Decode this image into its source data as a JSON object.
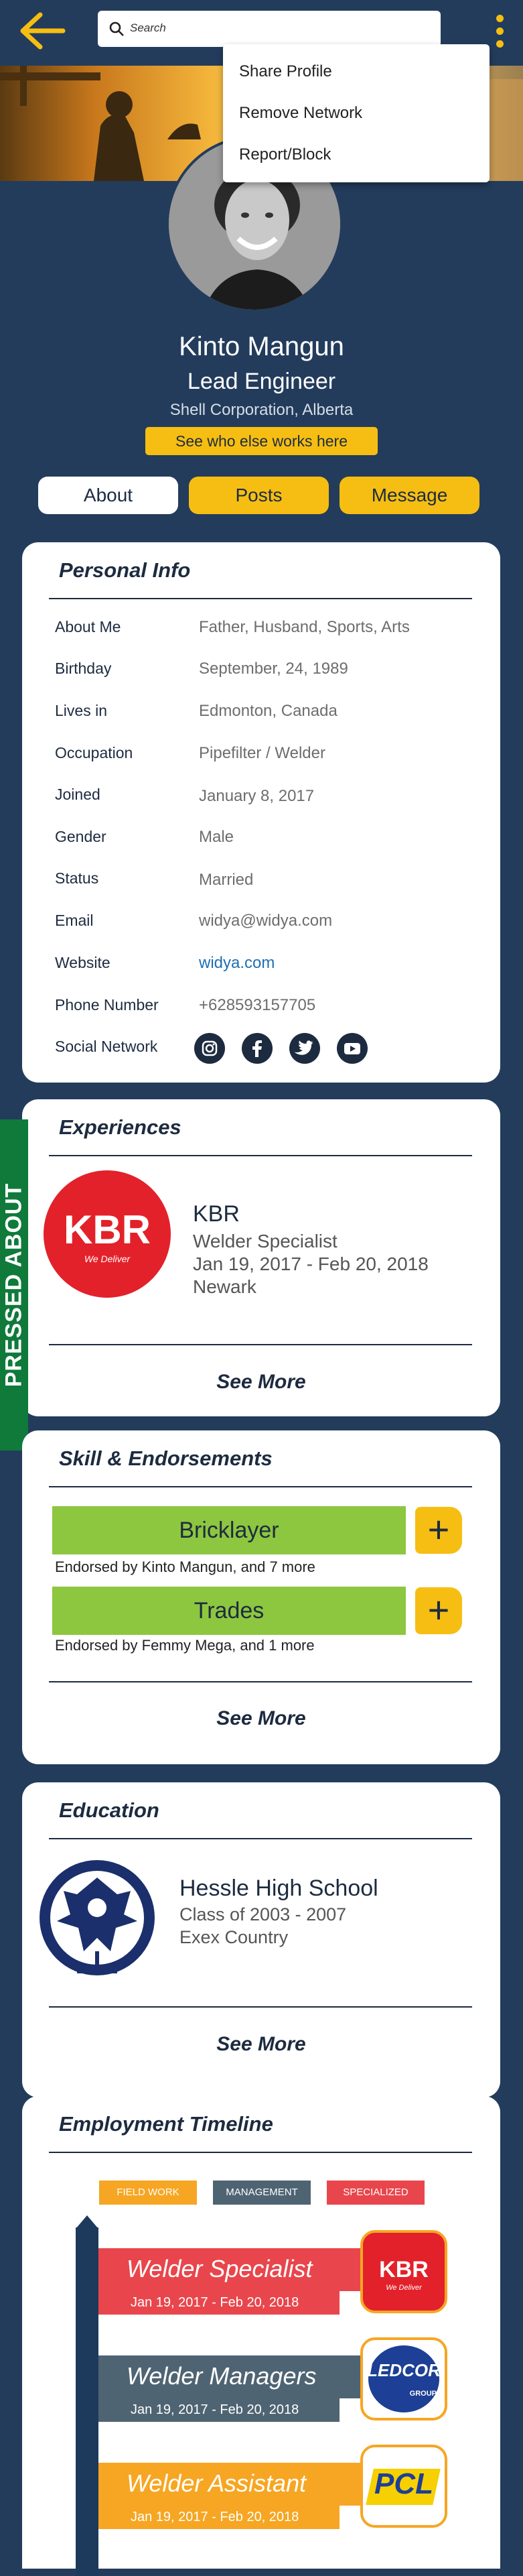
{
  "header": {
    "search_placeholder": "Search",
    "menu": [
      "Share Profile",
      "Remove Network",
      "Report/Block"
    ]
  },
  "profile": {
    "name": "Kinto Mangun",
    "role": "Lead Engineer",
    "company": "Shell Corporation, Alberta",
    "see_who": "See who else works here"
  },
  "tabs": [
    "About",
    "Posts",
    "Message"
  ],
  "personal_info": {
    "title": "Personal Info",
    "rows": [
      {
        "label": "About Me",
        "value": "Father, Husband, Sports, Arts"
      },
      {
        "label": "Birthday",
        "value": "September, 24, 1989"
      },
      {
        "label": "Lives in",
        "value": "Edmonton, Canada"
      },
      {
        "label": "Occupation",
        "value": "Pipefilter / Welder"
      },
      {
        "label": "Joined",
        "value": "January 8, 2017"
      },
      {
        "label": "Gender",
        "value": "Male"
      },
      {
        "label": "Status",
        "value": "Married"
      },
      {
        "label": "Email",
        "value": "widya@widya.com"
      },
      {
        "label": "Website",
        "value": "widya.com"
      },
      {
        "label": "Phone Number",
        "value": "+628593157705"
      },
      {
        "label": "Social Network",
        "value": ""
      }
    ],
    "social_icons": [
      "instagram-icon",
      "facebook-icon",
      "twitter-icon",
      "youtube-icon"
    ]
  },
  "pressed_label": "PRESSED ABOUT",
  "experiences": {
    "title": "Experiences",
    "logo_text": "KBR",
    "logo_tagline": "We Deliver",
    "company": "KBR",
    "position": "Welder Specialist",
    "dates": "Jan 19, 2017 - Feb 20, 2018",
    "location": "Newark",
    "see_more": "See More"
  },
  "skills": {
    "title": "Skill & Endorsements",
    "items": [
      {
        "name": "Bricklayer",
        "endorsed": "Endorsed by Kinto Mangun, and 7 more"
      },
      {
        "name": "Trades",
        "endorsed": "Endorsed by Femmy Mega, and 1 more"
      }
    ],
    "plus_symbol": "+",
    "see_more": "See More"
  },
  "education": {
    "title": "Education",
    "school": "Hessle High School",
    "class": "Class of 2003 - 2007",
    "location": "Exex Country",
    "see_more": "See More"
  },
  "timeline": {
    "title": "Employment Timeline",
    "legend": [
      "FIELD WORK",
      "MANAGEMENT",
      "SPECIALIZED"
    ],
    "legend_colors": [
      "#f6a623",
      "#4f6473",
      "#e8464c"
    ],
    "items": [
      {
        "title": "Welder Specialist",
        "dates": "Jan 19, 2017 - Feb 20, 2018",
        "logo": "KBR",
        "logo_sub": "We Deliver",
        "color": "#e8464c"
      },
      {
        "title": "Welder Managers",
        "dates": "Jan 19, 2017 - Feb 20, 2018",
        "logo": "LEDCOR",
        "logo_sub": "GROUP",
        "color": "#4f6473"
      },
      {
        "title": "Welder Assistant",
        "dates": "Jan 19, 2017 - Feb 20, 2018",
        "logo": "PCL",
        "logo_sub": "",
        "color": "#f6a623"
      }
    ]
  }
}
